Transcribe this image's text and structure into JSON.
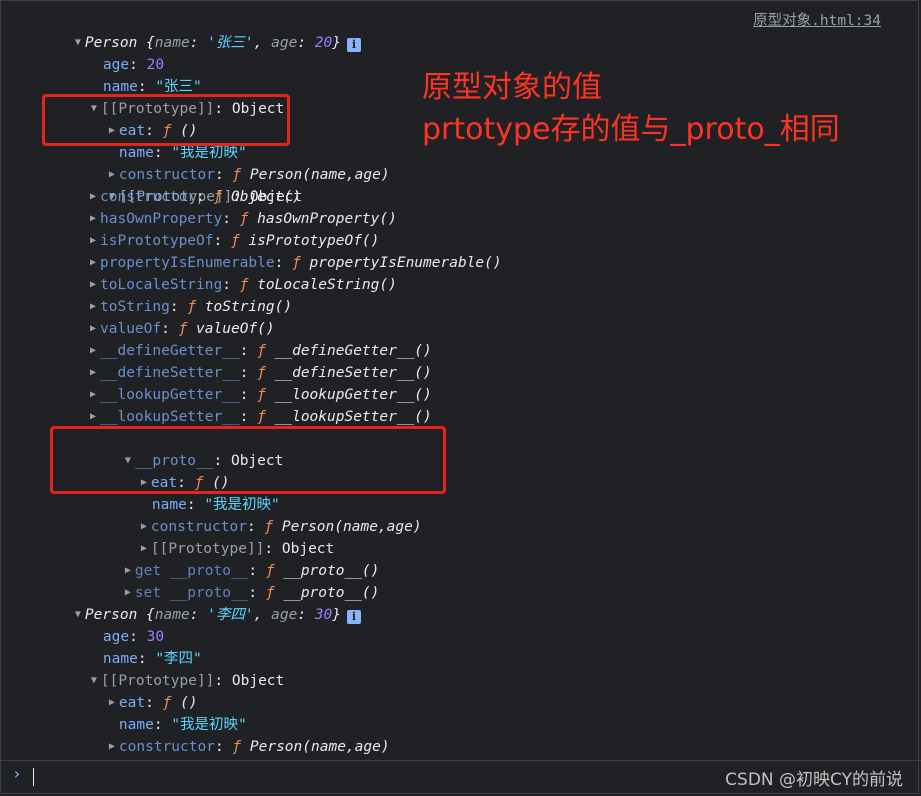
{
  "source_link": "原型对象.html:34",
  "annotation": {
    "line1": "原型对象的值",
    "line2": "prtotype存的值与_proto_相同"
  },
  "labels": {
    "person": "Person",
    "object": "Object",
    "prototype": "[[Prototype]]",
    "proto": "__proto__",
    "f": "ƒ",
    "colon": ":"
  },
  "objects": [
    {
      "summary": "{name: '张三', age: 20}",
      "summary_name": "'张三'",
      "summary_age": "20",
      "age": "20",
      "name": "\"张三\""
    },
    {
      "summary": "{name: '李四', age: 30}",
      "summary_name": "'李四'",
      "summary_age": "30",
      "age": "30",
      "name": "\"李四\""
    }
  ],
  "prototype": {
    "eat_key": "eat",
    "eat_value": "()",
    "name_key": "name",
    "name_value": "\"我是初映\"",
    "constructor_key": "constructor",
    "constructor_value": "Person(name,age)"
  },
  "object_proto_members": [
    {
      "key": "constructor",
      "value": "Object()"
    },
    {
      "key": "hasOwnProperty",
      "value": "hasOwnProperty()"
    },
    {
      "key": "isPrototypeOf",
      "value": "isPrototypeOf()"
    },
    {
      "key": "propertyIsEnumerable",
      "value": "propertyIsEnumerable()"
    },
    {
      "key": "toLocaleString",
      "value": "toLocaleString()"
    },
    {
      "key": "toString",
      "value": "toString()"
    },
    {
      "key": "valueOf",
      "value": "valueOf()"
    },
    {
      "key": "__defineGetter__",
      "value": "__defineGetter__()"
    },
    {
      "key": "__defineSetter__",
      "value": "__defineSetter__()"
    },
    {
      "key": "__lookupGetter__",
      "value": "__lookupGetter__()"
    },
    {
      "key": "__lookupSetter__",
      "value": "__lookupSetter__()"
    }
  ],
  "accessors": {
    "get_proto": "get __proto__",
    "get_proto_value": "__proto__()",
    "set_proto": "set __proto__",
    "set_proto_value": "__proto__()"
  },
  "watermark": "CSDN @初映CY的前说",
  "colors": {
    "background": "#202124",
    "key": "#7cacf8",
    "string": "#5cd5fb",
    "number": "#9980ff",
    "function_marker": "#f28b54",
    "highlight_box": "#e4251d",
    "annotation_text": "#ff3322"
  },
  "icons": {
    "expanded": "triangle-down-icon",
    "collapsed": "triangle-right-icon",
    "info": "info-icon",
    "prompt": "prompt-chevron-icon"
  }
}
